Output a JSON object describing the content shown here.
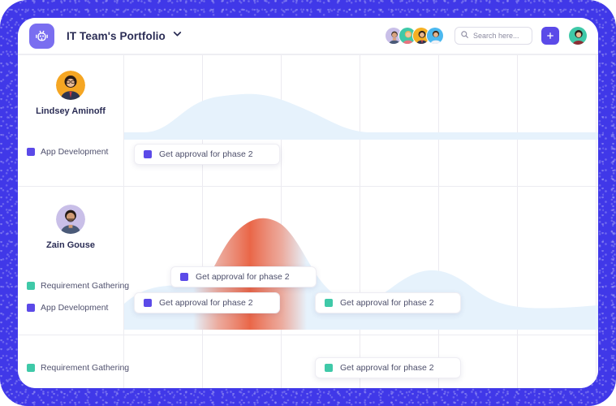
{
  "frame": {
    "border_color": "#4038e8"
  },
  "header": {
    "logo_icon": "robot-icon",
    "title": "IT Team's Portfolio",
    "dropdown_icon": "chevron-down-icon",
    "avatars": [
      {
        "name": "team-member-1",
        "bg": "#c9bfe8"
      },
      {
        "name": "team-member-2",
        "bg": "#3fc9a8"
      },
      {
        "name": "team-member-3",
        "bg": "#f5b023"
      },
      {
        "name": "team-member-4",
        "bg": "#4bb8ef"
      }
    ],
    "search": {
      "icon": "search-icon",
      "placeholder": "Search here..."
    },
    "add_button": {
      "icon": "plus-icon",
      "label": "+"
    },
    "current_user_avatar": {
      "name": "current-user-avatar",
      "bg": "#3fc9a8"
    }
  },
  "colors": {
    "app_development": "#5b4ae8",
    "requirement_gathering": "#3fc9a8",
    "wave_blue": "#e6f2fc",
    "overload_orange": "#f07050",
    "grid_line": "#eceaf0",
    "accent_purple": "#5b4ae8"
  },
  "rows": [
    {
      "id": "row-lindsey-aminoff",
      "person": {
        "name": "Lindsey Aminoff",
        "avatar_bg": "#f5a623"
      },
      "tags": [
        {
          "label": "App Development",
          "color": "#5b4ae8"
        }
      ],
      "tasks": [
        {
          "label": "Get approval for phase 2",
          "color": "#5b4ae8"
        }
      ],
      "workload_peak": "medium",
      "overloaded": false
    },
    {
      "id": "row-zain-gouse",
      "person": {
        "name": "Zain Gouse",
        "avatar_bg": "#c9bfe8"
      },
      "tags": [
        {
          "label": "Requirement Gathering",
          "color": "#3fc9a8"
        },
        {
          "label": "App Development",
          "color": "#5b4ae8"
        }
      ],
      "tasks": [
        {
          "label": "Get approval for phase 2",
          "color": "#5b4ae8"
        },
        {
          "label": "Get approval for phase 2",
          "color": "#5b4ae8"
        },
        {
          "label": "Get approval for phase 2",
          "color": "#3fc9a8"
        }
      ],
      "workload_peak": "high",
      "overloaded": true
    },
    {
      "id": "row-unassigned",
      "person": null,
      "tags": [
        {
          "label": "Requirement Gathering",
          "color": "#3fc9a8"
        }
      ],
      "tasks": [
        {
          "label": "Get approval for phase 2",
          "color": "#3fc9a8"
        }
      ],
      "workload_peak": "none",
      "overloaded": false
    }
  ]
}
